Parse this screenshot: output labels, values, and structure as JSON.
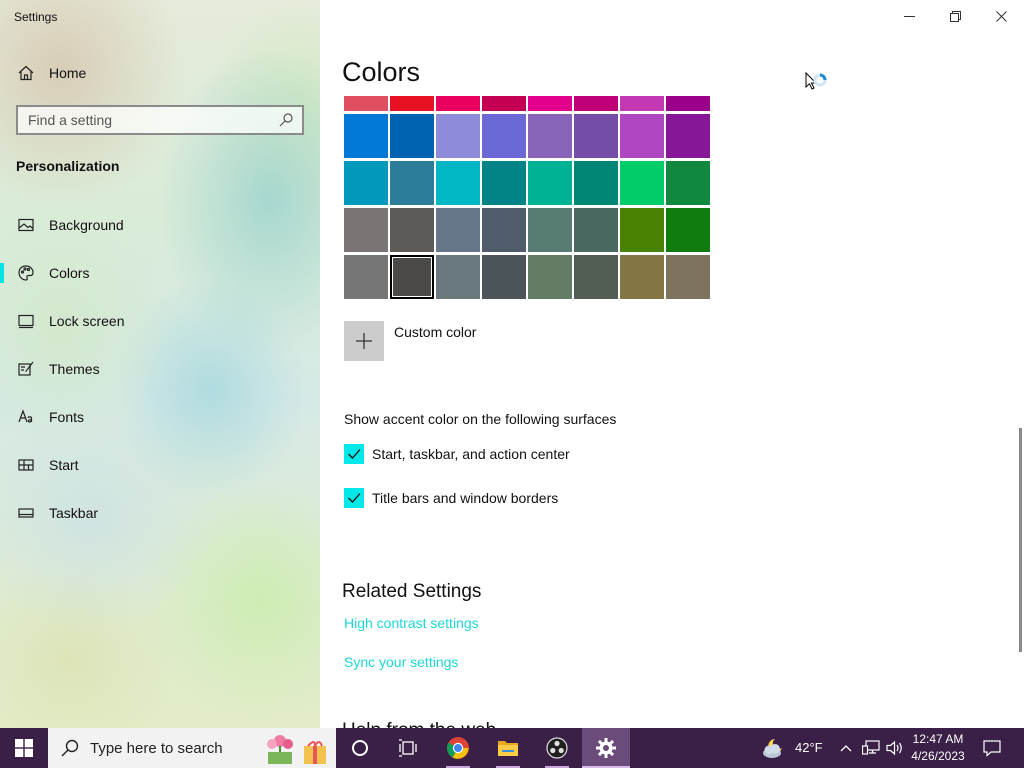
{
  "window": {
    "title": "Settings",
    "minimize_icon": "minimize-icon",
    "restore_icon": "restore-icon",
    "close_icon": "close-icon"
  },
  "sidebar": {
    "home_label": "Home",
    "search_placeholder": "Find a setting",
    "section_heading": "Personalization",
    "items": [
      {
        "label": "Background",
        "icon": "picture-icon",
        "active": false
      },
      {
        "label": "Colors",
        "icon": "palette-icon",
        "active": true
      },
      {
        "label": "Lock screen",
        "icon": "lock-screen-icon",
        "active": false
      },
      {
        "label": "Themes",
        "icon": "brush-icon",
        "active": false
      },
      {
        "label": "Fonts",
        "icon": "font-icon",
        "active": false
      },
      {
        "label": "Start",
        "icon": "start-menu-icon",
        "active": false
      },
      {
        "label": "Taskbar",
        "icon": "taskbar-icon",
        "active": false
      }
    ],
    "accent": "#00e4e4"
  },
  "main": {
    "title": "Colors",
    "swatches": {
      "partial_row": [
        "#e04f5f",
        "#e81123",
        "#ea005e",
        "#c30052",
        "#e3008c",
        "#bf0077",
        "#c239b3",
        "#9a0089"
      ],
      "rows": [
        [
          "#0078d7",
          "#0063b1",
          "#8e8cd8",
          "#6b69d6",
          "#8764b8",
          "#744da9",
          "#b146c2",
          "#881798"
        ],
        [
          "#0099bc",
          "#2d7d9a",
          "#00b7c3",
          "#038387",
          "#00b294",
          "#018574",
          "#00cc6a",
          "#10893e"
        ],
        [
          "#7a7574",
          "#5d5a58",
          "#68768a",
          "#515c6b",
          "#567c73",
          "#486860",
          "#498205",
          "#107c10"
        ],
        [
          "#767676",
          "#4c4a48",
          "#69797e",
          "#4a5459",
          "#647c64",
          "#525e54",
          "#847545",
          "#7e735f"
        ]
      ],
      "selected": {
        "row": 3,
        "col": 1
      }
    },
    "custom_color_label": "Custom color",
    "surfaces_heading": "Show accent color on the following surfaces",
    "checkboxes": [
      {
        "label": "Start, taskbar, and action center",
        "checked": true
      },
      {
        "label": "Title bars and window borders",
        "checked": true
      }
    ],
    "related_heading": "Related Settings",
    "links": [
      "High contrast settings",
      "Sync your settings"
    ],
    "cut_off_heading": "Help from the web"
  },
  "taskbar": {
    "search_placeholder": "Type here to search",
    "apps": [
      "cortana-icon",
      "task-view-icon",
      "chrome-icon",
      "file-explorer-icon",
      "obs-icon",
      "settings-gear-icon"
    ],
    "weather": "42°F",
    "time": "12:47 AM",
    "date": "4/26/2023"
  }
}
